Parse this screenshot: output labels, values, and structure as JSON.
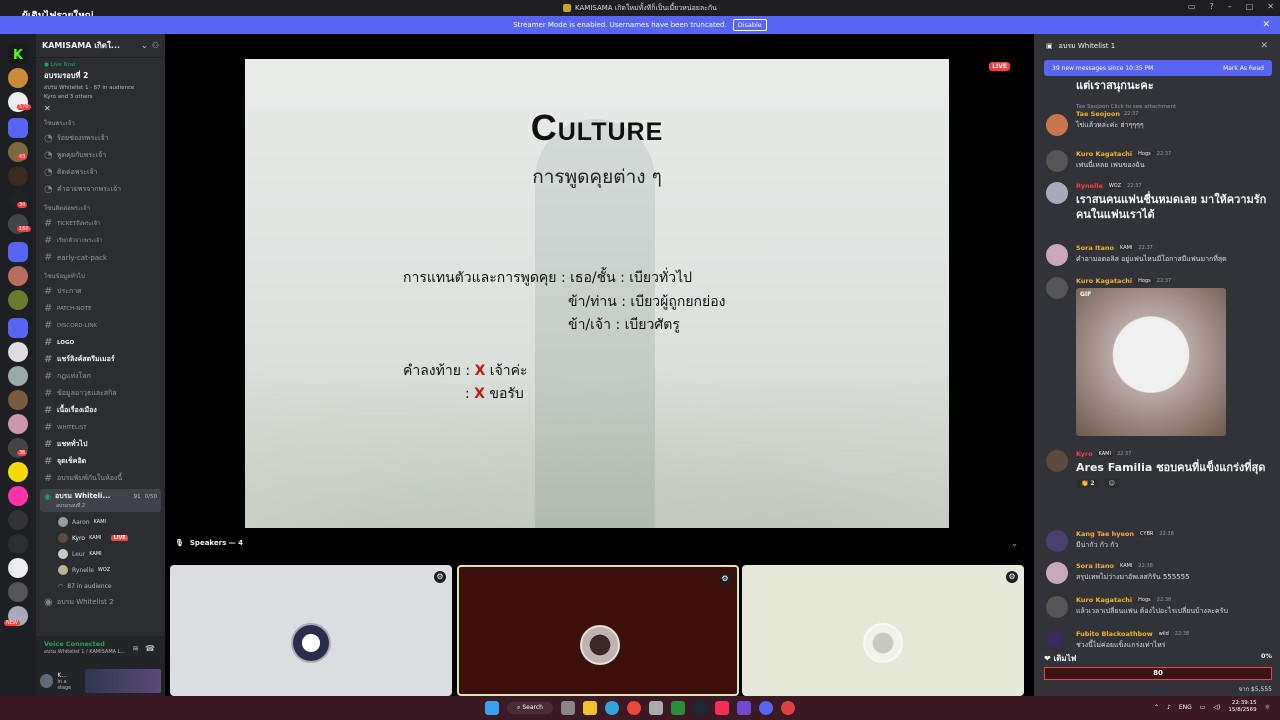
{
  "titlebar": {
    "left_text": "ผู้เติมไฟรายใหญ่",
    "title": "KAMISAMA เกิดใหม่ทั้งทีก็เป็นเมี้ยวหน่อยละกัน"
  },
  "streamer_bar": {
    "message": "Streamer Mode is enabled. Usernames have been truncated.",
    "disable_label": "Disable"
  },
  "rail": {
    "badges": [
      "32",
      "570",
      "43",
      "34",
      "160",
      "36",
      "1",
      "NEW"
    ]
  },
  "sidebar": {
    "server_name": "KAMISAMA เกิดใ...",
    "live": {
      "status": "Live Now",
      "event_title": "อบรมรอบที่ 2",
      "meta_channel": "อบรม Whitelist 1 · 87 in audience",
      "meta_people": "Kyro and 3 others"
    },
    "categories": [
      {
        "label": "โซนพระเจ้า",
        "channels": [
          "ร้อยช่องทพระเจ้า",
          "พูดคุยกับพระเจ้า",
          "ติดต่อพระเจ้า",
          "คำอวยพรจากพระเจ้า"
        ]
      },
      {
        "label": "โซนติดต่อพระเจ้า",
        "channels": [
          "TICKETถึงพระเจ้า",
          "เรียกตัวจากพระเจ้า",
          "early-cat-pack"
        ]
      },
      {
        "label": "โซนข้อมูลทั่วไป",
        "channels": [
          "ประกาศ",
          "PATCH-NOTE",
          "DISCORD-LINK",
          "LOGO",
          "แชร์ลิงค์สตรีมเมอร์",
          "กฎแห่งโลก",
          "ข้อมูลอาวุธและสกิล",
          "เนื้อเรื่องเมือง",
          "WHITELIST",
          "แชททั่วไป",
          "จุดเช็คอิด",
          "อบรมพิมพ์กันในห้องนี้"
        ]
      }
    ],
    "voice_channel": {
      "name": "อบรม Whiteli...",
      "sub": "อบรมรอบที่ 2",
      "count": "91",
      "limit": "0/50"
    },
    "members": [
      {
        "name": "Aaron",
        "tag": "KAMI",
        "live": ""
      },
      {
        "name": "Kyro",
        "tag": "KAMI",
        "live": "LIVE"
      },
      {
        "name": "Leur",
        "tag": "KAMI",
        "live": ""
      },
      {
        "name": "Rynelle",
        "tag": "WOZ",
        "live": ""
      }
    ],
    "audience": "87 in audience",
    "second_stage": "อบรม Whitelist 2",
    "voice_status": "Voice Connected",
    "voice_status_sub": "อบรม Whitelist 1 / KAMISAMA L...",
    "user_name": "K...",
    "user_status": "In a stage"
  },
  "stage": {
    "live_label": "LIVE",
    "slide": {
      "title": "Culture",
      "subtitle": "การพูดคุยต่าง ๆ",
      "line1": "การแทนตัวและการพูดคุย : เธอ/ชั้น : เบียวทั่วไป",
      "line2": "ข้า/ท่าน : เบียวผู้ถูกยกย่อง",
      "line3": "ข้า/เจ้า : เบียวศัตรู",
      "line4_prefix": "คำลงท้าย : ",
      "line4_x": "X",
      "line4_suffix": " เจ้าค่ะ",
      "line5_prefix": ": ",
      "line5_x": "X",
      "line5_suffix": " ขอรับ"
    },
    "speakers_label": "Speakers — 4"
  },
  "chat": {
    "header": "อบรม Whitelist 1",
    "new_messages": "39 new messages since 10:35 PM",
    "mark_as_read": "Mark As Read",
    "messages": [
      {
        "name": "",
        "time": "",
        "tag": "",
        "body": "แต่เราสนุกนะคะ",
        "big": true,
        "color": "#f2f3f5"
      },
      {
        "name": "Tae Seojoon",
        "time": "22:37",
        "tag": "",
        "body": "ไข่แล้วหล่ะค่ะ ฮ่าๆๆๆๆ",
        "big": false,
        "color": "#f0b232",
        "reply": "Tae Seojoon Click to see attachment"
      },
      {
        "name": "Kuro Kagatachi",
        "time": "22:37",
        "tag": "Hogs",
        "body": "เฟนนี่เหลย เฟนของฉัน",
        "big": false,
        "color": "#f0b232"
      },
      {
        "name": "Rynelle",
        "time": "22:37",
        "tag": "WOZ",
        "body": "เราสนคนแฟนชื่นหมดเลย มาให้ความรักคนในแฟนเราได้",
        "big": true,
        "color": "#f23f43"
      },
      {
        "name": "Sora Itano",
        "time": "22:37",
        "tag": "KAMI",
        "body": "คำอามอดอลิส อยู่แฟนไหนมีโอกาสมีแฟนมากที่สุด",
        "big": false,
        "color": "#f0b232"
      },
      {
        "name": "Kuro Kagatachi",
        "time": "22:37",
        "tag": "Hogs",
        "body": "",
        "big": false,
        "color": "#f0b232",
        "gif": "GIF"
      },
      {
        "name": "Kyro",
        "time": "22:37",
        "tag": "KAMI",
        "body": "Ares Familia ชอบคนที่แข็งแกร่งที่สุด",
        "big": true,
        "color": "#f23f43",
        "reaction": "2"
      },
      {
        "name": "Kang Tae hyeon",
        "time": "22:38",
        "tag": "CYBR",
        "body": "มีน่ากัว กัว กัว",
        "big": false,
        "color": "#f0b232"
      },
      {
        "name": "Sora Itano",
        "time": "22:38",
        "tag": "KAMI",
        "body": "สรุปเทพไม่ว่างมาอัพเลสกิรัน 555555",
        "big": false,
        "color": "#f0b232"
      },
      {
        "name": "Kuro Kagatachi",
        "time": "22:38",
        "tag": "Hogs",
        "body": "แล้วเวลาเปลี่ยนแฟน ต้องไปอะไรเปลี่ยนบ้างละครับ",
        "big": false,
        "color": "#f0b232"
      },
      {
        "name": "Fubito Blackoathbow",
        "time": "22:38",
        "tag": "wild",
        "body": "ช่วงนี้ไม่ค่อยแข็งแกร่งเท่าไหร่",
        "big": false,
        "color": "#f0b232"
      }
    ],
    "fuel_label": "เติมไฟ",
    "fuel_percent": "0%",
    "fuel_fraction": 0,
    "fuel_value": "80",
    "goal": "จาก $5,555"
  },
  "taskbar": {
    "search": "Search",
    "lang": "ENG",
    "time": "22:39:15",
    "date": "15/8/2569"
  }
}
